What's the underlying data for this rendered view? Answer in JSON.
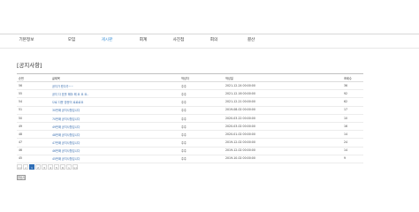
{
  "nav": {
    "items": [
      {
        "label": "기본정보"
      },
      {
        "label": "모임"
      },
      {
        "label": "게시판"
      },
      {
        "label": "회계"
      },
      {
        "label": "사진첩"
      },
      {
        "label": "회의"
      },
      {
        "label": "결산"
      }
    ],
    "active_index": 2
  },
  "page": {
    "title": "[공지사항]"
  },
  "table": {
    "headers": [
      "순번",
      "글제목",
      "작성자",
      "작성일",
      "조회수"
    ],
    "rows": [
      [
        "56",
        "공지가 왔다가~~",
        "주주",
        "2021-12-24 00:00:00",
        "36"
      ],
      [
        "55",
        "공지 다 표를 해야 해 요 요 요..",
        "주주",
        "2021-12-16 00:00:00",
        "92"
      ],
      [
        "54",
        "으로 다운 방문이 로로로요",
        "주주",
        "2021-12-21 00:00:00",
        "62"
      ],
      [
        "51",
        "30번째 공지사항입니다",
        "주주",
        "2019-08-02 00:00:00",
        "17"
      ],
      [
        "50",
        "70번째 공지사항입니다",
        "주주",
        "2020-03-22 00:00:00",
        "10"
      ],
      [
        "49",
        "49번째 공지사항입니다",
        "주주",
        "2020-03-02 00:00:00",
        "16"
      ],
      [
        "48",
        "48번째 공지사항입니다",
        "주주",
        "2020-01-02 00:00:00",
        "14"
      ],
      [
        "47",
        "47번째 공지사항입니다",
        "주주",
        "2019-12-02 00:00:00",
        "24"
      ],
      [
        "46",
        "46번째 공지사항입니다",
        "주주",
        "2019-12-02 00:00:00",
        "14"
      ],
      [
        "45",
        "45번째 공지사항입니다",
        "주주",
        "2019-10-02 00:00:00",
        "9"
      ]
    ]
  },
  "pagination": {
    "first_label": "<<",
    "prev_label": "<",
    "pages": [
      "1",
      "2",
      "3",
      "4",
      "5",
      "6"
    ],
    "active_page": "1",
    "next_label": ">",
    "last_label": ">>"
  },
  "actions": {
    "write_label": "글쓰기"
  },
  "colors": {
    "accent": "#3a8fd6",
    "pager_active": "#2f6db5"
  }
}
